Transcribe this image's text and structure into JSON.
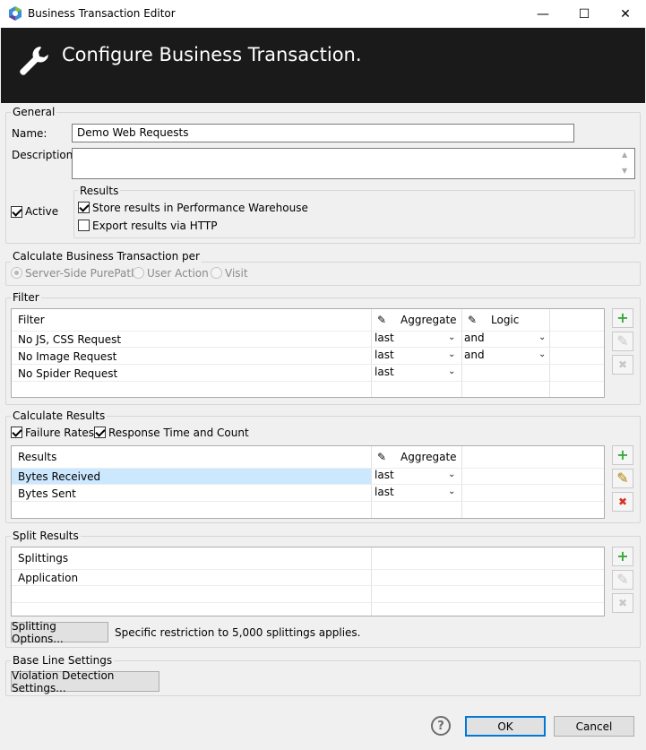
{
  "window": {
    "title": "Business Transaction Editor",
    "minimize": "—",
    "maximize": "☐",
    "close": "✕"
  },
  "header": {
    "title": "Configure Business Transaction."
  },
  "general": {
    "legend": "General",
    "name_label": "Name:",
    "name_value": "Demo Web Requests",
    "description_label": "Description:",
    "description_value": "",
    "active_label": "Active",
    "results_legend": "Results",
    "store_label": "Store results in Performance Warehouse",
    "export_label": "Export results via HTTP"
  },
  "calc_per": {
    "legend": "Calculate Business Transaction per",
    "options": [
      "Server-Side PurePath",
      "User Action",
      "Visit"
    ]
  },
  "filter": {
    "legend": "Filter",
    "headers": {
      "filter": "Filter",
      "aggregate": "Aggregate",
      "logic": "Logic"
    },
    "rows": [
      {
        "name": "No JS, CSS Request",
        "aggregate": "last",
        "logic": "and"
      },
      {
        "name": "No Image Request",
        "aggregate": "last",
        "logic": "and"
      },
      {
        "name": "No Spider Request",
        "aggregate": "last",
        "logic": ""
      }
    ]
  },
  "calc_results": {
    "legend": "Calculate Results",
    "failure_label": "Failure Rates",
    "response_label": "Response Time and Count",
    "headers": {
      "results": "Results",
      "aggregate": "Aggregate"
    },
    "rows": [
      {
        "name": "Bytes Received",
        "aggregate": "last"
      },
      {
        "name": "Bytes Sent",
        "aggregate": "last"
      }
    ]
  },
  "split": {
    "legend": "Split Results",
    "header": "Splittings",
    "rows": [
      "Application"
    ],
    "options_button": "Splitting Options...",
    "note": "Specific restriction to 5,000 splittings applies."
  },
  "baseline": {
    "legend": "Base Line Settings",
    "button": "Violation Detection Settings..."
  },
  "footer": {
    "help": "?",
    "ok": "OK",
    "cancel": "Cancel"
  },
  "icons": {
    "add": "+",
    "remove": "✖",
    "dropdown": "⌄",
    "edit": "✎"
  },
  "colors": {
    "add": "#3aa83a",
    "remove": "#d93025",
    "selected_row": "#cce8ff",
    "ok_border": "#0078d7"
  }
}
